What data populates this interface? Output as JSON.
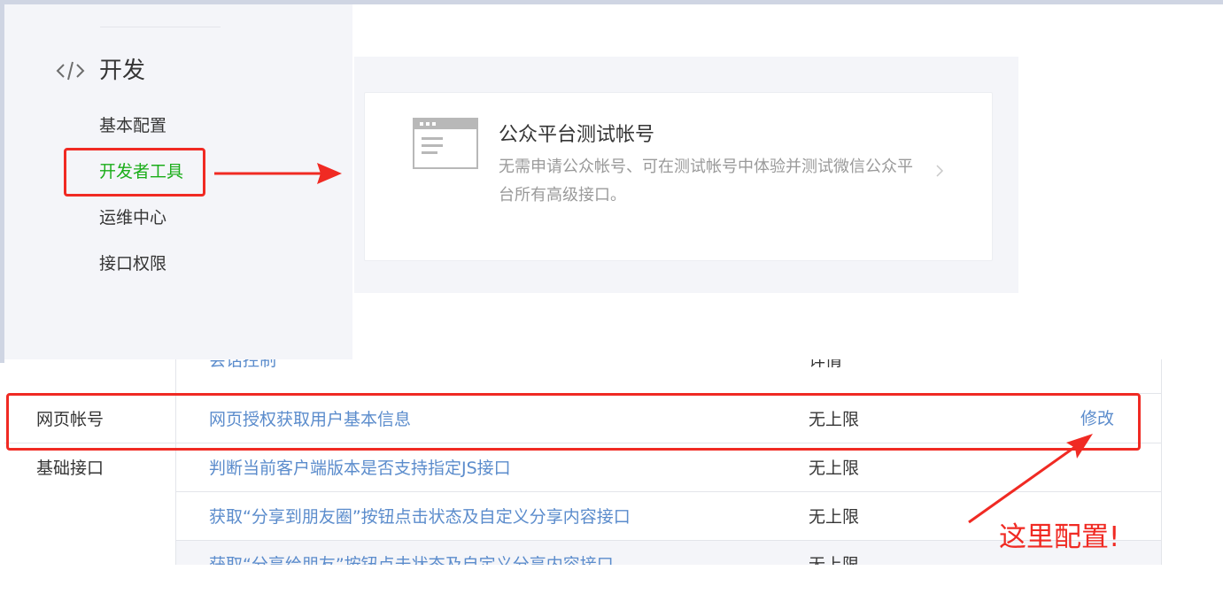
{
  "sidebar": {
    "section_icon": "code-icon",
    "section_title": "开发",
    "items": [
      {
        "label": "基本配置",
        "active": false
      },
      {
        "label": "开发者工具",
        "active": true
      },
      {
        "label": "运维中心",
        "active": false
      },
      {
        "label": "接口权限",
        "active": false
      }
    ]
  },
  "tool_card": {
    "icon": "browser-window-icon",
    "title": "公众平台测试帐号",
    "description": "无需申请公众帐号、可在测试帐号中体验并测试微信公众平台所有高级接口。",
    "chevron_icon": "chevron-right-icon"
  },
  "table": {
    "partial_top": {
      "api": "会话控制",
      "limit": "详情"
    },
    "rows": [
      {
        "category": "网页帐号",
        "api": "网页授权获取用户基本信息",
        "limit": "无上限",
        "operation": "修改"
      },
      {
        "category": "基础接口",
        "api": "判断当前客户端版本是否支持指定JS接口",
        "limit": "无上限",
        "operation": ""
      },
      {
        "category": "",
        "api": "获取“分享到朋友圈”按钮点击状态及自定义分享内容接口",
        "limit": "无上限",
        "operation": ""
      },
      {
        "category": "",
        "api": "获取“分享给朋友”按钮点击状态及自定义分享内容接口",
        "limit": "无上限",
        "operation": ""
      }
    ]
  },
  "annotation": {
    "note": "这里配置!",
    "color": "#f02a23"
  },
  "colors": {
    "accent_green": "#1aad19",
    "link_blue": "#5b8ccc",
    "panel_bg": "#f4f5f9"
  }
}
